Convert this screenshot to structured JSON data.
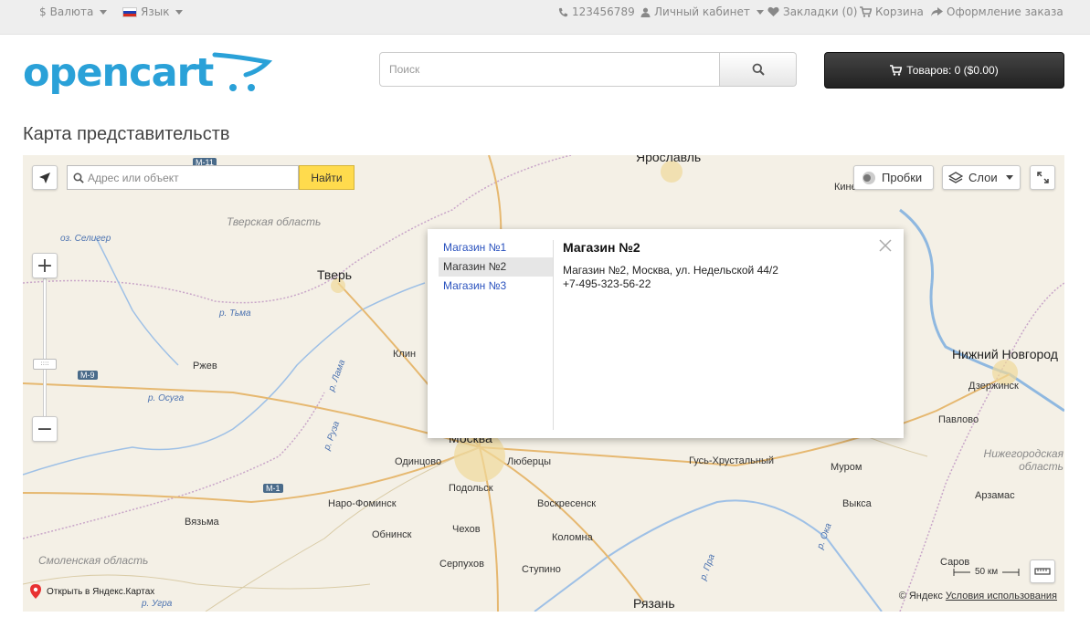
{
  "topbar": {
    "currency": "Валюта",
    "language": "Язык",
    "phone": "123456789",
    "account": "Личный кабинет",
    "wishlist": "Закладки (0)",
    "cart": "Корзина",
    "checkout": "Оформление заказа"
  },
  "header": {
    "logo_text": "opencart",
    "search_placeholder": "Поиск",
    "cart_button": "Товаров: 0 ($0.00)"
  },
  "page": {
    "title": "Карта представительств"
  },
  "map": {
    "address_placeholder": "Адрес или объект",
    "find_button": "Найти",
    "traffic_button": "Пробки",
    "layers_button": "Слои",
    "open_in_yandex": "Открыть в Яндекс.Картах",
    "copyright": "© Яндекс",
    "terms_link": "Условия использования",
    "scale_label": "50 км",
    "popup": {
      "stores": [
        "Магазин №1",
        "Магазин №2",
        "Магазин №3"
      ],
      "active_index": 1,
      "title": "Магазин №2",
      "address": "Магазин №2, Москва, ул. Недельской 44/2",
      "phone": "+7-495-323-56-22"
    },
    "labels": {
      "cities": [
        "Ярославль",
        "Кинешма",
        "Тверь",
        "Клин",
        "Ржев",
        "Нижний Новгород",
        "Дзержинск",
        "Павлово",
        "Москва",
        "Одинцово",
        "Люберцы",
        "Подольск",
        "Наро-Фоминск",
        "Воскресенск",
        "Гусь-Хрустальный",
        "Муром",
        "Вязьма",
        "Обнинск",
        "Чехов",
        "Коломна",
        "Выкса",
        "Арзамас",
        "Серпухов",
        "Ступино",
        "Рязань",
        "Саров"
      ],
      "regions": [
        "Тверская область",
        "Смоленская область",
        "Нижегородская область"
      ],
      "rivers": [
        "оз. Селигер",
        "р. Тьма",
        "р. Осуга",
        "р. Лама",
        "р. Руза",
        "р. Угра",
        "р. Ока",
        "р. Пра"
      ],
      "roads": [
        "M-11",
        "M-9",
        "M-1"
      ]
    }
  }
}
